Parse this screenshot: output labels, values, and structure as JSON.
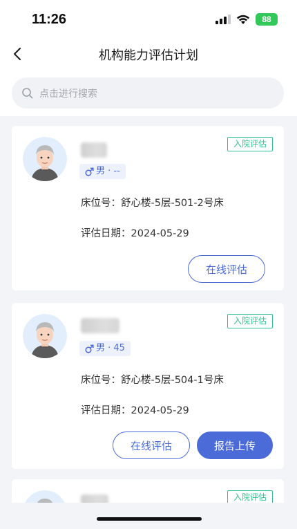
{
  "status_bar": {
    "time": "11:26",
    "battery": "88"
  },
  "nav": {
    "title": "机构能力评估计划"
  },
  "search": {
    "placeholder": "点击进行搜索"
  },
  "cards": [
    {
      "tag": "入院评估",
      "gender_text": "男 · --",
      "bed_label": "床位号：",
      "bed_value": "舒心楼-5层-501-2号床",
      "date_label": "评估日期：",
      "date_value": "2024-05-29",
      "primary_button": "在线评估"
    },
    {
      "tag": "入院评估",
      "gender_text": "男 · 45",
      "bed_label": "床位号：",
      "bed_value": "舒心楼-5层-504-1号床",
      "date_label": "评估日期：",
      "date_value": "2024-05-29",
      "primary_button": "在线评估",
      "secondary_button": "报告上传"
    },
    {
      "tag": "入院评估"
    }
  ],
  "colors": {
    "accent": "#4a6bd8",
    "tag_green": "#2ec48f",
    "background": "#f3f4f7"
  }
}
